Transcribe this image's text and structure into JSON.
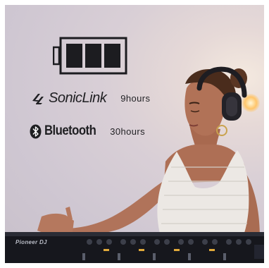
{
  "features": [
    {
      "brand": "SonicLink",
      "duration": "9hours",
      "icon": "soniclink-logo-icon"
    },
    {
      "brand": "Bluetooth",
      "duration": "30hours",
      "icon": "bluetooth-icon"
    }
  ],
  "battery": {
    "level": 1.0,
    "cells": 3,
    "icon": "battery-icon"
  },
  "equipment": {
    "brand": "Pioneer DJ"
  },
  "colors": {
    "ink": "#1f1f22",
    "background": "#d9cfd6"
  }
}
